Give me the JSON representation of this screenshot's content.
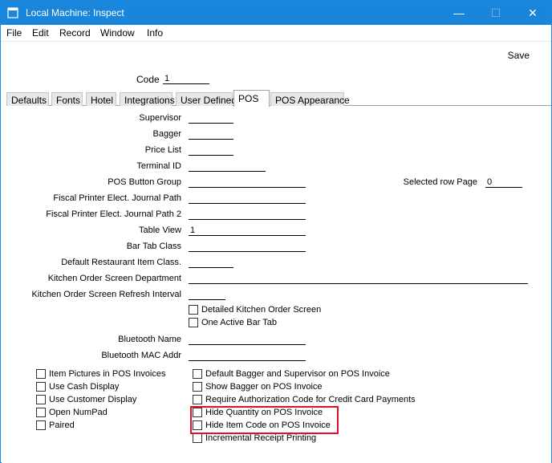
{
  "window": {
    "title": "Local Machine: Inspect",
    "controls": {
      "minimize": "—",
      "maximize": "☐",
      "close": "✕"
    }
  },
  "menu": [
    "File",
    "Edit",
    "Record",
    "Window",
    "Info"
  ],
  "toolbar": {
    "save_label": "Save"
  },
  "code": {
    "label": "Code",
    "value": "1"
  },
  "tabs": [
    "Defaults",
    "Fonts",
    "Hotel",
    "Integrations",
    "User Defined",
    "POS",
    "POS Appearance"
  ],
  "active_tab": "POS",
  "fields": {
    "supervisor": {
      "label": "Supervisor",
      "value": ""
    },
    "bagger": {
      "label": "Bagger",
      "value": ""
    },
    "price_list": {
      "label": "Price List",
      "value": ""
    },
    "terminal_id": {
      "label": "Terminal ID",
      "value": ""
    },
    "pos_button_group": {
      "label": "POS Button Group",
      "value": ""
    },
    "selected_row_page": {
      "label": "Selected row Page",
      "value": "0"
    },
    "fiscal_journal_path": {
      "label": "Fiscal Printer Elect. Journal Path",
      "value": ""
    },
    "fiscal_journal_path2": {
      "label": "Fiscal Printer Elect. Journal Path 2",
      "value": ""
    },
    "table_view": {
      "label": "Table View",
      "value": "1"
    },
    "bar_tab_class": {
      "label": "Bar Tab Class",
      "value": ""
    },
    "default_restaurant_item_class": {
      "label": "Default Restaurant Item Class.",
      "value": ""
    },
    "kitchen_order_screen_department": {
      "label": "Kitchen Order Screen Department",
      "value": ""
    },
    "kitchen_order_refresh": {
      "label": "Kitchen Order Screen Refresh Interval",
      "value": ""
    },
    "bluetooth_name": {
      "label": "Bluetooth Name",
      "value": ""
    },
    "bluetooth_mac": {
      "label": "Bluetooth MAC Addr",
      "value": ""
    }
  },
  "checkboxes": {
    "detailed_kitchen_order_screen": {
      "label": "Detailed Kitchen Order Screen",
      "checked": false
    },
    "one_active_bar_tab": {
      "label": "One Active Bar Tab",
      "checked": false
    },
    "item_pictures": {
      "label": "Item Pictures in POS Invoices",
      "checked": false
    },
    "use_cash_display": {
      "label": "Use Cash Display",
      "checked": false
    },
    "use_customer_display": {
      "label": "Use Customer Display",
      "checked": false
    },
    "open_numpad": {
      "label": "Open NumPad",
      "checked": false
    },
    "paired": {
      "label": "Paired",
      "checked": false
    },
    "default_bagger_supervisor": {
      "label": "Default Bagger and Supervisor on POS Invoice",
      "checked": false
    },
    "show_bagger": {
      "label": "Show Bagger on POS Invoice",
      "checked": false
    },
    "require_auth_code": {
      "label": "Require Authorization Code for Credit Card Payments",
      "checked": false
    },
    "hide_quantity": {
      "label": "Hide Quantity on POS Invoice",
      "checked": false
    },
    "hide_item_code": {
      "label": "Hide Item Code on POS Invoice",
      "checked": false
    },
    "incremental_receipt": {
      "label": "Incremental Receipt Printing",
      "checked": false
    }
  },
  "colors": {
    "titlebar": "#1a86db",
    "highlight": "#e0102a",
    "tab_bg": "#e8e8e8"
  },
  "icons": {
    "app": "app-window-icon"
  }
}
